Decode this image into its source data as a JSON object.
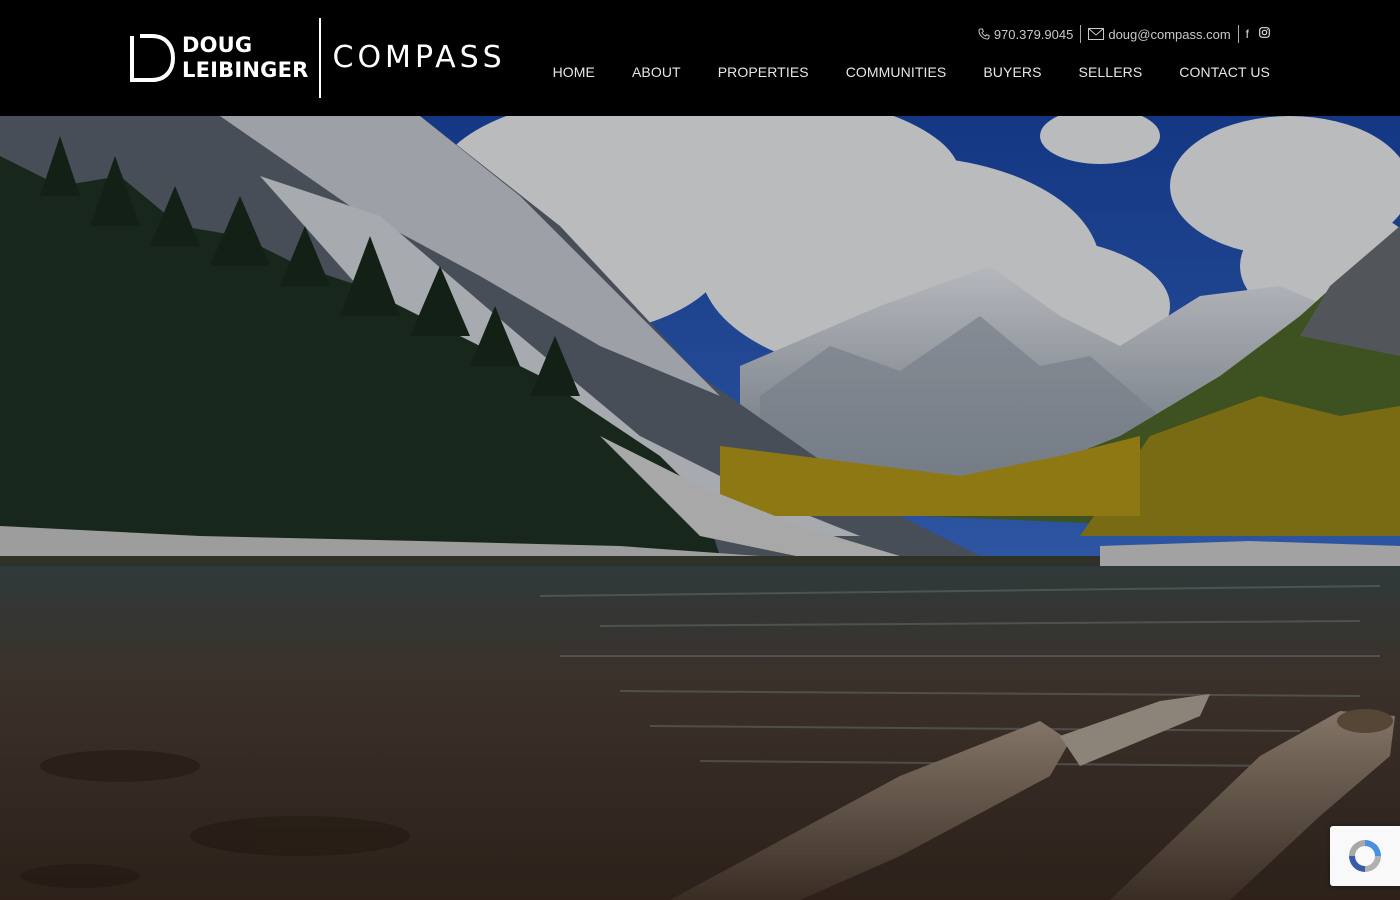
{
  "brand": {
    "name_line1": "DOUG",
    "name_line2": "LEIBINGER",
    "partner": "COMPASS"
  },
  "contact": {
    "phone": "970.379.9045",
    "email": "doug@compass.com"
  },
  "social": [
    {
      "icon": "facebook-icon",
      "glyph": "f"
    },
    {
      "icon": "instagram-icon",
      "glyph": "◎"
    }
  ],
  "nav": [
    {
      "label": "HOME"
    },
    {
      "label": "ABOUT"
    },
    {
      "label": "PROPERTIES"
    },
    {
      "label": "COMMUNITIES"
    },
    {
      "label": "BUYERS"
    },
    {
      "label": "SELLERS"
    },
    {
      "label": "CONTACT US"
    }
  ],
  "colors": {
    "header_bg": "#000000",
    "nav_text": "#e6e6e6",
    "sky": "#1c4fb3"
  },
  "widgets": {
    "recaptcha_icon": "recaptcha-icon"
  }
}
